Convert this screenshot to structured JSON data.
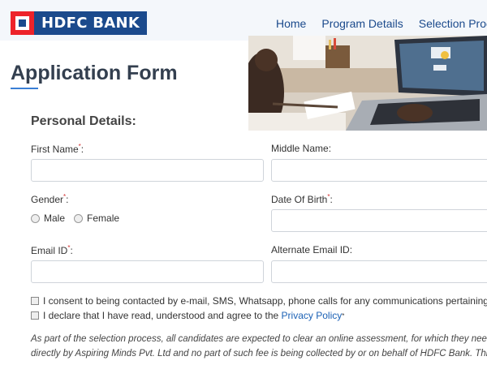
{
  "brand": {
    "name": "HDFC BANK",
    "primary": "#1b4a8c",
    "accent": "#ed232a"
  },
  "nav": {
    "items": [
      "Home",
      "Program Details",
      "Selection Process"
    ]
  },
  "page": {
    "title": "Application Form"
  },
  "personal": {
    "section_title": "Personal Details:",
    "first_name_label": "First Name",
    "middle_name_label": "Middle Name:",
    "gender_label": "Gender",
    "dob_label": "Date Of Birth",
    "email_label": "Email ID",
    "alt_email_label": "Alternate Email ID:",
    "required_mark": "*",
    "gender_options": [
      "Male",
      "Female"
    ]
  },
  "consent": {
    "contact_text": "I consent to being contacted by e-mail, SMS, Whatsapp, phone calls for any communications pertaining to",
    "declare_text": "I declare that I have read, understood and agree to the ",
    "privacy_link": "Privacy Policy"
  },
  "note": {
    "line1": "As part of the selection process, all candidates are expected to clear an online assessment, for which they need t",
    "line2": "directly by Aspiring Minds Pvt. Ltd and no part of such fee is being collected by or on behalf of HDFC Bank. This"
  }
}
